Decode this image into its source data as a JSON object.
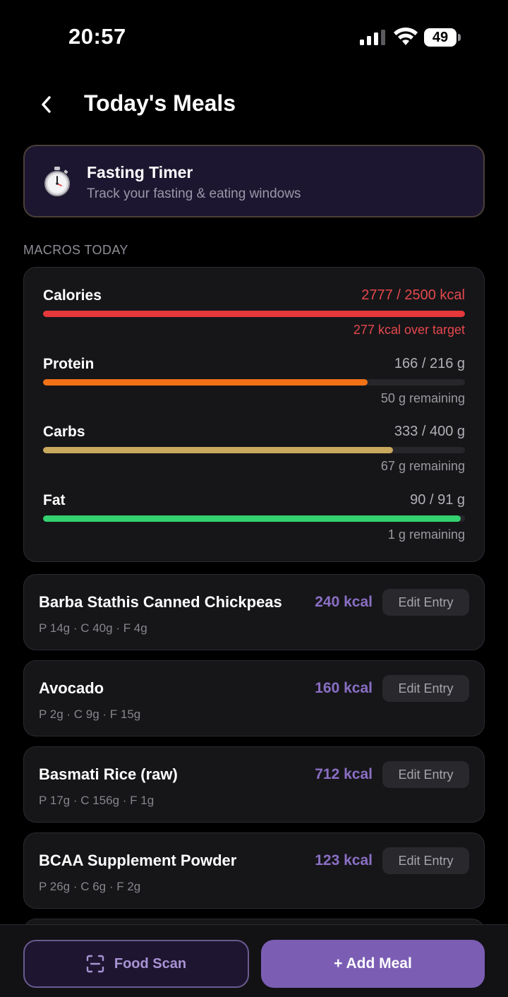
{
  "status_bar": {
    "time": "20:57",
    "battery": "49"
  },
  "header": {
    "title": "Today's Meals"
  },
  "fasting": {
    "title": "Fasting Timer",
    "subtitle": "Track your fasting & eating windows"
  },
  "macros": {
    "section_label": "MACROS TODAY",
    "items": [
      {
        "name": "Calories",
        "value": "2777 / 2500 kcal",
        "note": "277 kcal over target",
        "progress": 1.0,
        "color": "#e5383b"
      },
      {
        "name": "Protein",
        "value": "166 / 216 g",
        "note": "50 g remaining",
        "progress": 0.77,
        "color": "#f47216"
      },
      {
        "name": "Carbs",
        "value": "333 / 400 g",
        "note": "67 g remaining",
        "progress": 0.83,
        "color": "#c9a95e"
      },
      {
        "name": "Fat",
        "value": "90 / 91 g",
        "note": "1 g remaining",
        "progress": 0.99,
        "color": "#34d170"
      }
    ]
  },
  "meals": [
    {
      "name": "Barba Stathis Canned Chickpeas",
      "kcal": "240 kcal",
      "macros": "P 14g · C 40g · F 4g",
      "edit_label": "Edit Entry"
    },
    {
      "name": "Avocado",
      "kcal": "160 kcal",
      "macros": "P 2g · C 9g · F 15g",
      "edit_label": "Edit Entry"
    },
    {
      "name": "Basmati Rice (raw)",
      "kcal": "712 kcal",
      "macros": "P 17g · C 156g · F 1g",
      "edit_label": "Edit Entry"
    },
    {
      "name": "BCAA Supplement Powder",
      "kcal": "123 kcal",
      "macros": "P 26g · C 6g · F 2g",
      "edit_label": "Edit Entry"
    }
  ],
  "bottom_bar": {
    "food_scan_label": "Food Scan",
    "add_meal_label": "+ Add Meal"
  },
  "colors": {
    "accent": "#7b5eb4",
    "kcal": "#8a6fc4",
    "over_target": "#e5383b"
  },
  "icons": [
    "chevron-left-icon",
    "stopwatch-icon",
    "scan-icon",
    "signal-icon",
    "wifi-icon",
    "battery-icon"
  ]
}
